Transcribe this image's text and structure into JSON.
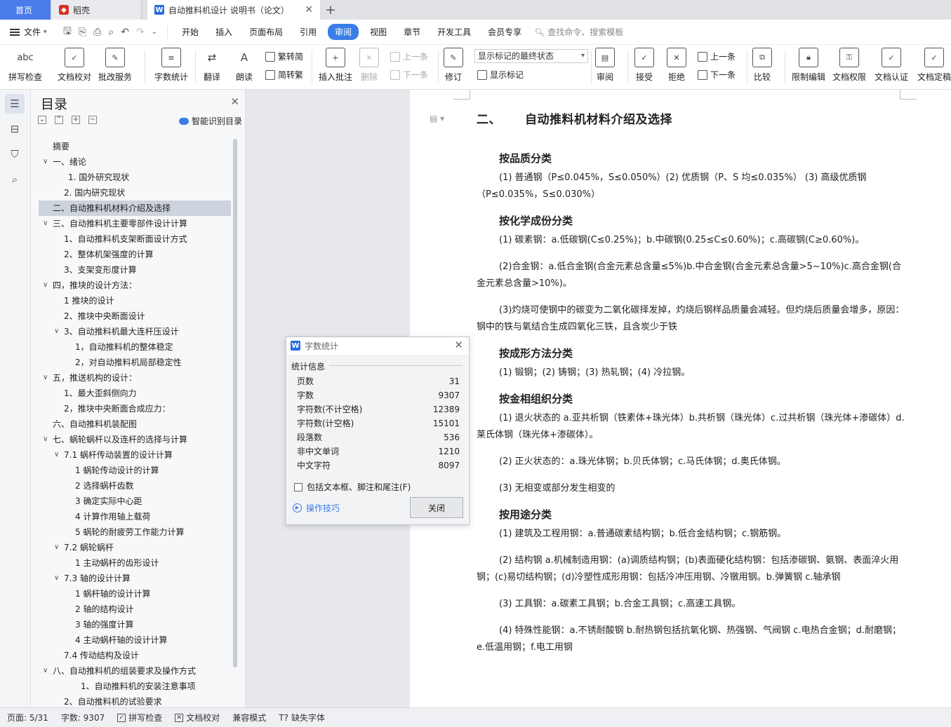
{
  "tabs": {
    "home": "首页",
    "daoke": "稻壳",
    "doc": "自动推料机设计 说明书（论文）"
  },
  "menu": {
    "file": "文件",
    "items": [
      "开始",
      "插入",
      "页面布局",
      "引用",
      "审阅",
      "视图",
      "章节",
      "开发工具",
      "会员专享"
    ],
    "active_index": 4,
    "search": "查找命令、搜索模板"
  },
  "ribbon": {
    "spell": "拼写检查",
    "proof": "文档校对",
    "revise_service": "批改服务",
    "word_count": "字数统计",
    "translate": "翻译",
    "read": "朗读",
    "trad": "繁转简",
    "simp": "简转繁",
    "insert_comment": "插入批注",
    "delete": "删除",
    "prev": "上一条",
    "next": "下一条",
    "track": "修订",
    "show_select": "显示标记的最终状态",
    "show_marks": "显示标记",
    "review": "审阅",
    "accept": "接受",
    "reject": "拒绝",
    "prev2": "上一条",
    "next2": "下一条",
    "compare": "比较",
    "restrict": "限制编辑",
    "permission": "文档权限",
    "certify": "文档认证",
    "finalize": "文档定稿"
  },
  "toc": {
    "title": "目录",
    "smart": "智能识别目录",
    "items": [
      {
        "text": "摘要",
        "indent": 20,
        "arrow": false
      },
      {
        "text": "一、绪论",
        "indent": 20,
        "arrow": true
      },
      {
        "text": "1. 国外研究现状",
        "indent": 42,
        "arrow": false
      },
      {
        "text": "2. 国内研究现状",
        "indent": 36,
        "arrow": false
      },
      {
        "text": "二、自动推料机材料介绍及选择",
        "indent": 20,
        "arrow": false,
        "selected": true
      },
      {
        "text": "三、自动推料机主要零部件设计计算",
        "indent": 20,
        "arrow": true
      },
      {
        "text": "1、自动推料机支架断面设计方式",
        "indent": 36,
        "arrow": false
      },
      {
        "text": "2、整体机架强度的计算",
        "indent": 36,
        "arrow": false
      },
      {
        "text": "3、支架变形度计算",
        "indent": 36,
        "arrow": false
      },
      {
        "text": "四，推块的设计方法：",
        "indent": 20,
        "arrow": true
      },
      {
        "text": "1 推块的设计",
        "indent": 36,
        "arrow": false
      },
      {
        "text": "2、推块中央断面设计",
        "indent": 36,
        "arrow": false
      },
      {
        "text": "3、自动推料机最大连杆压设计",
        "indent": 36,
        "arrow": true
      },
      {
        "text": "1，自动推料机的整体稳定",
        "indent": 52,
        "arrow": false
      },
      {
        "text": "2，对自动推料机局部稳定性",
        "indent": 52,
        "arrow": false
      },
      {
        "text": "五，推送机构的设计：",
        "indent": 20,
        "arrow": true
      },
      {
        "text": "1、最大歪斜侧向力",
        "indent": 36,
        "arrow": false
      },
      {
        "text": "2，推块中央断面合成应力：",
        "indent": 36,
        "arrow": false
      },
      {
        "text": "六、自动推料机装配图",
        "indent": 20,
        "arrow": false
      },
      {
        "text": "七、蜗轮蜗杆以及连杆的选择与计算",
        "indent": 20,
        "arrow": true
      },
      {
        "text": "7.1  蜗杆传动装置的设计计算",
        "indent": 36,
        "arrow": true
      },
      {
        "text": "1  蜗轮传动设计的计算",
        "indent": 52,
        "arrow": false
      },
      {
        "text": "2  选择蜗杆齿数",
        "indent": 52,
        "arrow": false
      },
      {
        "text": "3  确定实际中心距",
        "indent": 52,
        "arrow": false
      },
      {
        "text": "4  计算作用轴上载荷",
        "indent": 52,
        "arrow": false
      },
      {
        "text": "5  蜗轮的耐疲劳工作能力计算",
        "indent": 52,
        "arrow": false
      },
      {
        "text": "7.2    蜗轮蜗杆",
        "indent": 36,
        "arrow": true
      },
      {
        "text": "1  主动蜗杆的齿形设计",
        "indent": 52,
        "arrow": false
      },
      {
        "text": "7.3    轴的设计计算",
        "indent": 36,
        "arrow": true
      },
      {
        "text": "1    蜗杆轴的设计计算",
        "indent": 52,
        "arrow": false
      },
      {
        "text": "2 轴的结构设计",
        "indent": 52,
        "arrow": false
      },
      {
        "text": "3    轴的强度计算",
        "indent": 52,
        "arrow": false
      },
      {
        "text": "4  主动蜗杆轴的设计计算",
        "indent": 52,
        "arrow": false
      },
      {
        "text": "7.4  传动结构及设计",
        "indent": 36,
        "arrow": false
      },
      {
        "text": "八、自动推料机的组装要求及操作方式",
        "indent": 20,
        "arrow": true
      },
      {
        "text": "1、自动推料机的安装注意事项",
        "indent": 60,
        "arrow": false
      },
      {
        "text": "2、自动推料机的试验要求",
        "indent": 36,
        "arrow": false
      }
    ]
  },
  "doc": {
    "heading_num": "二、",
    "heading": "自动推料机材料介绍及选择",
    "blocks": [
      {
        "type": "h2",
        "text": "按品质分类"
      },
      {
        "type": "p",
        "text": "(1) 普通钢（P≤0.045%，S≤0.050%）(2) 优质钢（P、S 均≤0.035%） (3) 高级优质钢（P≤0.035%，S≤0.030%）",
        "tight": true
      },
      {
        "type": "h2",
        "text": "按化学成份分类"
      },
      {
        "type": "p",
        "text": "(1) 碳素钢：a.低碳钢(C≤0.25%)；b.中碳钢(0.25≤C≤0.60%)；c.高碳钢(C≥0.60%)。"
      },
      {
        "type": "p",
        "text": "(2)合金钢：a.低合金钢(合金元素总含量≤5%)b.中合金钢(合金元素总含量>5~10%)c.高合金钢(合金元素总含量>10%)。"
      },
      {
        "type": "p",
        "text": "(3)灼烧可使钢中的碳变为二氧化碳择发掉，灼烧后钢样品质量会减轻。但灼烧后质量会增多，原因：钢中的铁与氧结合生成四氧化三铁，且含炭少于铁"
      },
      {
        "type": "h2",
        "text": "按成形方法分类"
      },
      {
        "type": "p",
        "text": "(1) 锻钢；(2) 铸钢；(3) 热轧钢；(4) 冷拉钢。",
        "tight": true
      },
      {
        "type": "h2",
        "text": "按金相组织分类"
      },
      {
        "type": "p",
        "text": "(1) 退火状态的 a.亚共析钢（铁素体+珠光体）b.共析钢（珠光体）c.过共析钢（珠光体+渗碳体）d.莱氏体钢（珠光体+渗碳体）。"
      },
      {
        "type": "p",
        "text": "(2) 正火状态的：a.珠光体钢；b.贝氏体钢；c.马氏体钢；d.奥氏体钢。"
      },
      {
        "type": "p",
        "text": "(3) 无相变或部分发生相变的",
        "tight": true
      },
      {
        "type": "h2",
        "text": "按用途分类"
      },
      {
        "type": "p",
        "text": "(1) 建筑及工程用钢：a.普通碳素结构钢；b.低合金结构钢；c.钢筋钢。"
      },
      {
        "type": "p",
        "text": "(2) 结构钢 a.机械制造用钢：(a)调质结构钢；(b)表面硬化结构钢：包括渗碳钢、氨钢、表面淬火用钢；(c)易切结构钢；(d)冷塑性成形用钢：包括冷冲压用钢、冷镦用钢。b.弹簧钢 c.轴承钢"
      },
      {
        "type": "p",
        "text": "(3) 工具钢：a.碳素工具钢；b.合金工具钢；c.高速工具钢。"
      },
      {
        "type": "p",
        "text": "(4) 特殊性能钢：a.不锈耐酸钢 b.耐热钢包括抗氧化钢、热强钢、气阀钢 c.电热合金钢；d.耐磨钢；e.低温用钢；f.电工用钢"
      }
    ]
  },
  "dialog": {
    "title": "字数统计",
    "section": "统计信息",
    "stats": [
      {
        "label": "页数",
        "value": "31"
      },
      {
        "label": "字数",
        "value": "9307"
      },
      {
        "label": "字符数(不计空格)",
        "value": "12389"
      },
      {
        "label": "字符数(计空格)",
        "value": "15101"
      },
      {
        "label": "段落数",
        "value": "536"
      },
      {
        "label": "非中文单词",
        "value": "1210"
      },
      {
        "label": "中文字符",
        "value": "8097"
      }
    ],
    "checkbox": "包括文本框、脚注和尾注(F)",
    "tips": "操作技巧",
    "close": "关闭"
  },
  "status": {
    "page": "页面: 5/31",
    "words": "字数: 9307",
    "spell": "拼写检查",
    "proof": "文档校对",
    "compat": "兼容模式",
    "missing_font": "缺失字体"
  }
}
